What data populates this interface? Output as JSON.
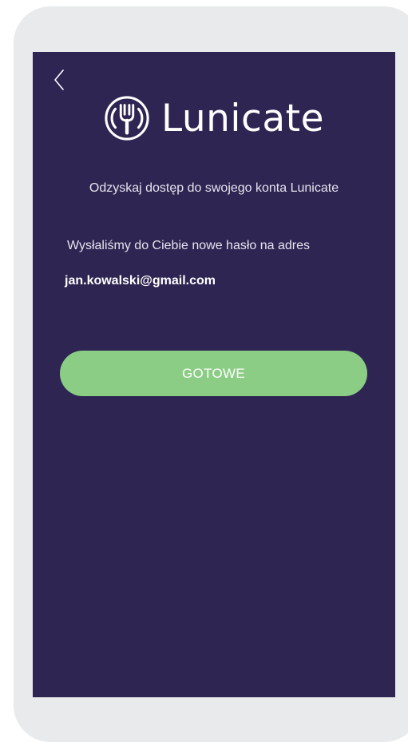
{
  "app": {
    "brand_name": "Lunicate"
  },
  "icons": {
    "back": "chevron-left-icon",
    "logo": "fork-plate-icon"
  },
  "content": {
    "subtitle": "Odzyskaj dostęp do swojego konta Lunicate",
    "info": "Wysłaliśmy do Ciebie nowe hasło na adres",
    "email": "jan.kowalski@gmail.com"
  },
  "actions": {
    "done_label": "GOTOWE"
  },
  "colors": {
    "frame": "#e9eaec",
    "background": "#2e2552",
    "accent": "#8bcd84",
    "text": "#ffffff"
  }
}
